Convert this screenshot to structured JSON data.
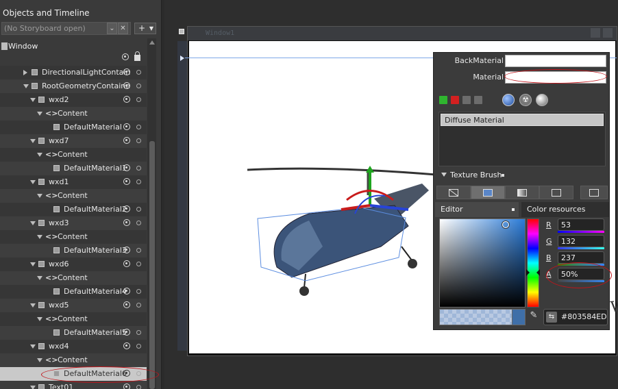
{
  "objects_panel": {
    "title": "Objects and Timeline",
    "storyboard_placeholder": "(No Storyboard open)",
    "add_label": "+",
    "root_label": "Window",
    "rows": [
      {
        "label": "DirectionalLightContain",
        "indent": 0,
        "kind": "cube",
        "expander": "closed"
      },
      {
        "label": "RootGeometryContaine",
        "indent": 0,
        "kind": "cube",
        "expander": "open"
      },
      {
        "label": "wxd2",
        "indent": 1,
        "kind": "cube",
        "expander": "open"
      },
      {
        "label": "Content",
        "indent": 2,
        "kind": "code",
        "expander": "open"
      },
      {
        "label": "DefaultMaterial",
        "indent": 3,
        "kind": "cube",
        "expander": "none"
      },
      {
        "label": "wxd7",
        "indent": 1,
        "kind": "cube",
        "expander": "open"
      },
      {
        "label": "Content",
        "indent": 2,
        "kind": "code",
        "expander": "open"
      },
      {
        "label": "DefaultMaterial1",
        "indent": 3,
        "kind": "cube",
        "expander": "none"
      },
      {
        "label": "wxd1",
        "indent": 1,
        "kind": "cube",
        "expander": "open"
      },
      {
        "label": "Content",
        "indent": 2,
        "kind": "code",
        "expander": "open"
      },
      {
        "label": "DefaultMaterial2",
        "indent": 3,
        "kind": "cube",
        "expander": "none"
      },
      {
        "label": "wxd3",
        "indent": 1,
        "kind": "cube",
        "expander": "open"
      },
      {
        "label": "Content",
        "indent": 2,
        "kind": "code",
        "expander": "open"
      },
      {
        "label": "DefaultMaterial3",
        "indent": 3,
        "kind": "cube",
        "expander": "none"
      },
      {
        "label": "wxd6",
        "indent": 1,
        "kind": "cube",
        "expander": "open"
      },
      {
        "label": "Content",
        "indent": 2,
        "kind": "code",
        "expander": "open"
      },
      {
        "label": "DefaultMaterial4",
        "indent": 3,
        "kind": "cube",
        "expander": "none"
      },
      {
        "label": "wxd5",
        "indent": 1,
        "kind": "cube",
        "expander": "open"
      },
      {
        "label": "Content",
        "indent": 2,
        "kind": "code",
        "expander": "open"
      },
      {
        "label": "DefaultMaterial5",
        "indent": 3,
        "kind": "cube",
        "expander": "none"
      },
      {
        "label": "wxd4",
        "indent": 1,
        "kind": "cube",
        "expander": "open"
      },
      {
        "label": "Content",
        "indent": 2,
        "kind": "code",
        "expander": "open"
      },
      {
        "label": "DefaultMaterial6",
        "indent": 3,
        "kind": "cube",
        "expander": "none",
        "selected": true
      },
      {
        "label": "Text01",
        "indent": 1,
        "kind": "cube",
        "expander": "open"
      }
    ]
  },
  "artboard": {
    "window_title": "Window1",
    "canvas_text": "W"
  },
  "properties": {
    "back_material_label": "BackMaterial",
    "material_label": "Material",
    "material_list": [
      "Diffuse Material"
    ],
    "texture_brush_label": "Texture Brush",
    "editor_tab": "Editor",
    "color_resources_tab": "Color resources",
    "channels": [
      {
        "label": "R",
        "value": "53",
        "bar": "linear-gradient(to right,#0000ff,#ff00ff)"
      },
      {
        "label": "G",
        "value": "132",
        "bar": "linear-gradient(to right,#3535ed,#35ffed)"
      },
      {
        "label": "B",
        "value": "237",
        "bar": "linear-gradient(to right,#358400,#3584ff)"
      },
      {
        "label": "A",
        "value": "50%",
        "bar": "linear-gradient(to right,#444,#3584ed)"
      }
    ],
    "hex_value": "#803584ED"
  },
  "colors": {
    "selected_color": "#3584ED",
    "annotation_red": "#c0151b"
  }
}
